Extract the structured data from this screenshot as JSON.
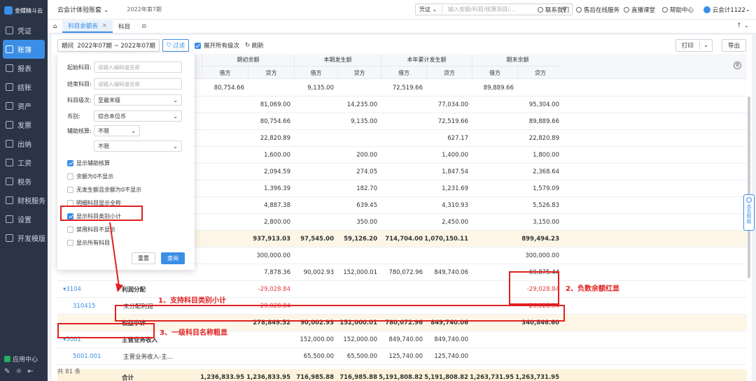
{
  "brand": "金蝶精斗云",
  "sidebar": {
    "items": [
      {
        "label": "凭证",
        "active": false
      },
      {
        "label": "账簿",
        "active": true
      },
      {
        "label": "报表",
        "active": false
      },
      {
        "label": "结账",
        "active": false
      },
      {
        "label": "资产",
        "active": false
      },
      {
        "label": "发票",
        "active": false
      },
      {
        "label": "出纳",
        "active": false
      },
      {
        "label": "工资",
        "active": false
      },
      {
        "label": "税务",
        "active": false
      },
      {
        "label": "财税服务",
        "active": false
      },
      {
        "label": "设置",
        "active": false
      },
      {
        "label": "开发模版",
        "active": false
      }
    ],
    "app_center": "应用中心"
  },
  "topbar": {
    "account": "云会计体验账套",
    "period": "2022年第7期",
    "search_select": "凭证",
    "search_placeholder": "输入金额/科目/核算项目/...",
    "links": [
      "联系我们",
      "售后在线服务",
      "直播课堂",
      "帮助中心"
    ],
    "user": "云会计1122"
  },
  "tabs": [
    {
      "label": "科目余额表",
      "active": true
    },
    {
      "label": "科目",
      "active": false
    }
  ],
  "toolbar": {
    "period_label": "期间",
    "period_value": "2022年07期 ~ 2022年07期",
    "filter": "过滤",
    "expand_all": "展开所有级次",
    "refresh": "刷新",
    "print": "打印",
    "export": "导出"
  },
  "table": {
    "groups": [
      "期初余额",
      "本期发生额",
      "本年累计发生额",
      "期末余额"
    ],
    "sub": [
      "借方",
      "贷方"
    ],
    "rows": [
      {
        "code": "",
        "name": "",
        "v": [
          "80,754.66",
          "",
          "9,135.00",
          "",
          "72,519.66",
          "",
          "89,889.66",
          ""
        ],
        "kind": ""
      },
      {
        "code": "",
        "name": "",
        "v": [
          "",
          "81,069.00",
          "",
          "14,235.00",
          "",
          "77,034.00",
          "",
          "95,304.00"
        ],
        "kind": ""
      },
      {
        "code": "",
        "name": "",
        "v": [
          "",
          "80,754.66",
          "",
          "9,135.00",
          "",
          "72,519.66",
          "",
          "89,889.66"
        ],
        "kind": ""
      },
      {
        "code": "",
        "name": "",
        "v": [
          "",
          "22,820.89",
          "",
          "",
          "",
          "627.17",
          "",
          "22,820.89"
        ],
        "kind": ""
      },
      {
        "code": "",
        "name": "",
        "v": [
          "",
          "1,600.00",
          "",
          "200.00",
          "",
          "1,400.00",
          "",
          "1,800.00"
        ],
        "kind": ""
      },
      {
        "code": "",
        "name": "",
        "v": [
          "",
          "2,094.59",
          "",
          "274.05",
          "",
          "1,847.54",
          "",
          "2,368.64"
        ],
        "kind": ""
      },
      {
        "code": "",
        "name": "",
        "v": [
          "",
          "1,396.39",
          "",
          "182.70",
          "",
          "1,231.69",
          "",
          "1,579.09"
        ],
        "kind": ""
      },
      {
        "code": "",
        "name": "",
        "v": [
          "",
          "4,887.38",
          "",
          "639.45",
          "",
          "4,310.93",
          "",
          "5,526.83"
        ],
        "kind": ""
      },
      {
        "code": "",
        "name": "",
        "v": [
          "",
          "2,800.00",
          "",
          "350.00",
          "",
          "2,450.00",
          "",
          "3,150.00"
        ],
        "kind": ""
      },
      {
        "code": "",
        "name": "",
        "v": [
          "",
          "937,913.03",
          "97,545.00",
          "59,126.20",
          "714,704.00",
          "1,070,150.11",
          "",
          "899,494.23"
        ],
        "kind": "sub"
      },
      {
        "code": "",
        "name": "",
        "v": [
          "",
          "300,000.00",
          "",
          "",
          "",
          "",
          "",
          "300,000.00"
        ],
        "kind": ""
      },
      {
        "code": "",
        "name": "",
        "v": [
          "",
          "7,878.36",
          "90,002.93",
          "152,000.01",
          "780,072.96",
          "849,740.06",
          "",
          "69,875.44"
        ],
        "kind": ""
      },
      {
        "code": "3104",
        "name": "利润分配",
        "v": [
          "",
          "-29,028.84",
          "",
          "",
          "",
          "",
          "",
          "-29,028.84"
        ],
        "kind": "l1"
      },
      {
        "code": "310415",
        "name": "未分配利润",
        "v": [
          "",
          "-29,028.84",
          "",
          "",
          "",
          "",
          "",
          "-29,028.84"
        ],
        "kind": "l2"
      },
      {
        "code": "",
        "name": "权益小计",
        "v": [
          "",
          "278,849.52",
          "90,002.93",
          "152,000.01",
          "780,072.96",
          "849,740.06",
          "",
          "340,846.60"
        ],
        "kind": "sub"
      },
      {
        "code": "5001",
        "name": "主营业务收入",
        "v": [
          "",
          "",
          "152,000.00",
          "152,000.00",
          "849,740.00",
          "849,740.00",
          "",
          ""
        ],
        "kind": "l1"
      },
      {
        "code": "5001.001",
        "name": "主营业务收入-主...",
        "v": [
          "",
          "",
          "65,500.00",
          "65,500.00",
          "125,740.00",
          "125,740.00",
          "",
          ""
        ],
        "kind": "l2"
      }
    ],
    "total": {
      "name": "合计",
      "v": [
        "1,236,833.95",
        "1,236,833.95",
        "716,985.88",
        "716,985.88",
        "5,191,808.82",
        "5,191,808.82",
        "1,263,731.95",
        "1,263,731.95"
      ]
    },
    "count_text": "共 81 条"
  },
  "filter_panel": {
    "start_label": "起始科目:",
    "start_placeholder": "请输入编码或名称",
    "end_label": "结束科目:",
    "end_placeholder": "请输入编码或名称",
    "level_label": "科目级次:",
    "level_value": "至最末级",
    "currency_label": "币别:",
    "currency_value": "综合本位币",
    "aux_label": "辅助核算:",
    "aux_value": "不限",
    "aux_value2": "不限",
    "checks": [
      {
        "label": "显示辅助核算",
        "on": true
      },
      {
        "label": "余额为0不显示",
        "on": false
      },
      {
        "label": "无发生额且余额为0不显示",
        "on": false
      },
      {
        "label": "明细科目显示全称",
        "on": false
      },
      {
        "label": "显示科目类别小计",
        "on": true
      },
      {
        "label": "禁用科目不显示",
        "on": false
      },
      {
        "label": "显示所有科目",
        "on": false
      }
    ],
    "reset": "重置",
    "query": "查询"
  },
  "annotations": {
    "a1": "1、支持科目类别小计",
    "a2": "2、负数余额红显",
    "a3": "3、一级科目名称粗显"
  },
  "help_float": "本页帮助"
}
